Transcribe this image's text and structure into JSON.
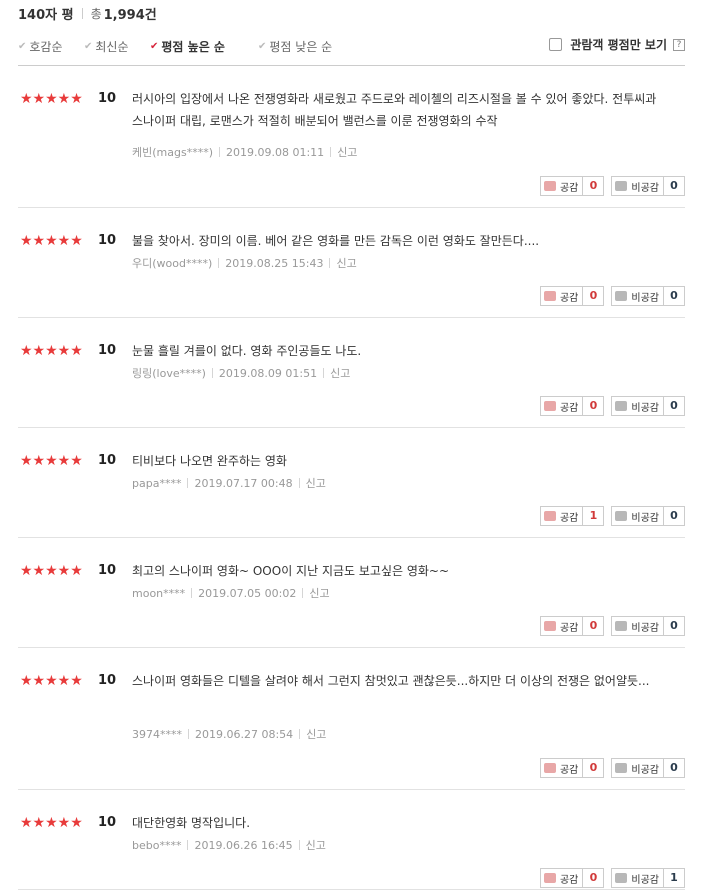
{
  "header": {
    "title": "140자 평",
    "total_label": "총",
    "total_count": "1,994건"
  },
  "filters": [
    {
      "label": "호감순",
      "active": false
    },
    {
      "label": "최신순",
      "active": false
    },
    {
      "label": "평점 높은 순",
      "active": true
    },
    {
      "label": "평점 낮은 순",
      "active": false
    }
  ],
  "audience_only_label": "관람객 평점만 보기",
  "help_label": "?",
  "labels": {
    "like": "공감",
    "dislike": "비공감",
    "report": "신고"
  },
  "stars": "★★★★★",
  "reviews": [
    {
      "score": "10",
      "text": "러시아의 입장에서 나온 전쟁영화라 새로웠고 주드로와 레이첼의 리즈시절을 볼 수 있어 좋았다. 전투씨과 스나이퍼 대립, 로맨스가 적절히 배분되어 밸런스를 이룬 전쟁영화의 수작",
      "author": "케빈(mags****)",
      "date": "2019.09.08 01:11",
      "likes": "0",
      "dislikes": "0"
    },
    {
      "score": "10",
      "text": "불을 찾아서. 장미의 이름. 베어 같은 영화를 만든 감독은 이런 영화도 잘만든다....",
      "author": "우디(wood****)",
      "date": "2019.08.25 15:43",
      "likes": "0",
      "dislikes": "0"
    },
    {
      "score": "10",
      "text": "눈물 흘릴 겨를이 없다. 영화 주인공들도 나도.",
      "author": "링링(love****)",
      "date": "2019.08.09 01:51",
      "likes": "0",
      "dislikes": "0"
    },
    {
      "score": "10",
      "text": "티비보다 나오면 완주하는 영화",
      "author": "papa****",
      "date": "2019.07.17 00:48",
      "likes": "1",
      "dislikes": "0"
    },
    {
      "score": "10",
      "text": "최고의 스나이퍼 영화~ OOO이 지난 지금도 보고싶은 영화~~",
      "author": "moon****",
      "date": "2019.07.05 00:02",
      "likes": "0",
      "dislikes": "0"
    },
    {
      "score": "10",
      "text": "스나이퍼 영화들은 디텔을 살려야 해서 그런지 참멋있고 괜찮은듯...하지만 더 이상의 전쟁은 없어얄듯...",
      "author": "3974****",
      "date": "2019.06.27 08:54",
      "likes": "0",
      "dislikes": "0"
    },
    {
      "score": "10",
      "text": "대단한영화 명작입니다.",
      "author": "bebo****",
      "date": "2019.06.26 16:45",
      "likes": "0",
      "dislikes": "1"
    }
  ]
}
